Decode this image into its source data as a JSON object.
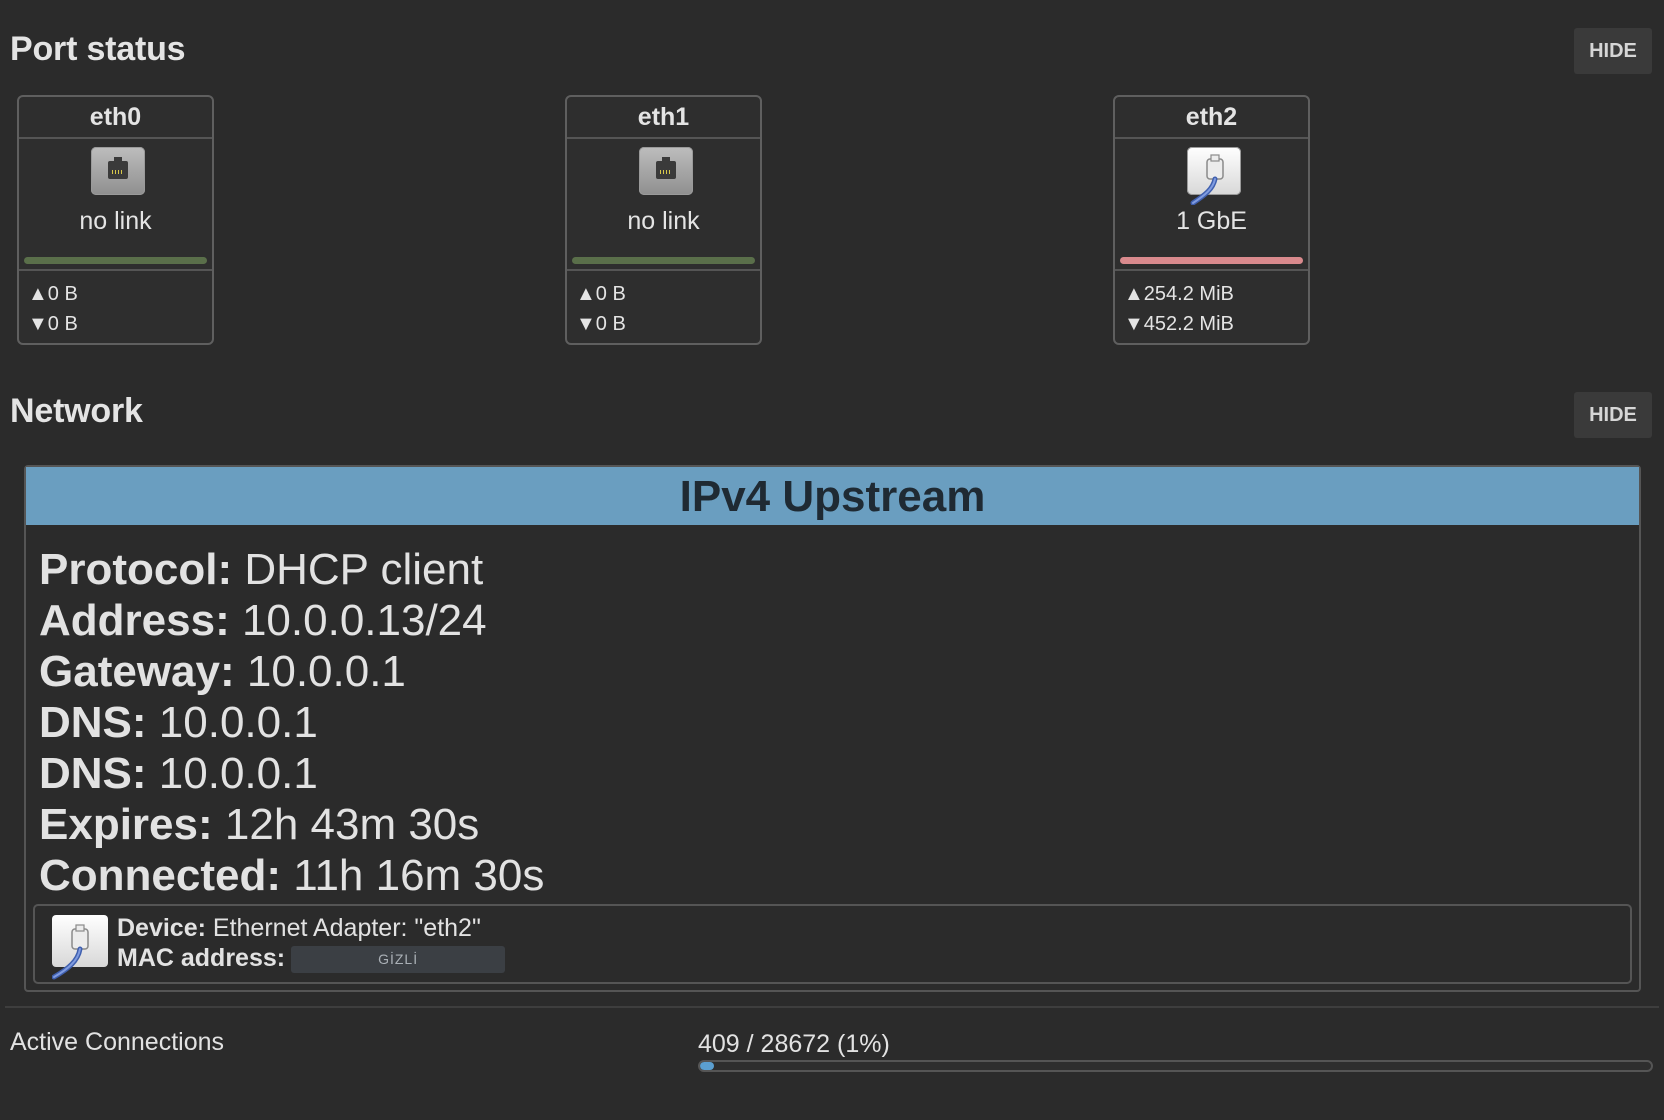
{
  "port_status": {
    "title": "Port status",
    "hide_label": "HIDE",
    "ports": [
      {
        "name": "eth0",
        "status": "no link",
        "up": false,
        "bar_color": "#5a6f4a",
        "tx": "0 B",
        "rx": "0 B"
      },
      {
        "name": "eth1",
        "status": "no link",
        "up": false,
        "bar_color": "#5a6f4a",
        "tx": "0 B",
        "rx": "0 B"
      },
      {
        "name": "eth2",
        "status": "1 GbE",
        "up": true,
        "bar_color": "#d98a8d",
        "tx": "254.2 MiB",
        "rx": "452.2 MiB"
      }
    ]
  },
  "network": {
    "title": "Network",
    "hide_label": "HIDE",
    "upstream": {
      "title": "IPv4 Upstream",
      "header_color": "#6a9ec0",
      "rows": [
        {
          "label": "Protocol:",
          "value": "DHCP client"
        },
        {
          "label": "Address:",
          "value": "10.0.0.13/24"
        },
        {
          "label": "Gateway:",
          "value": "10.0.0.1"
        },
        {
          "label": "DNS:",
          "value": "10.0.0.1"
        },
        {
          "label": "DNS:",
          "value": "10.0.0.1"
        },
        {
          "label": "Expires:",
          "value": "12h 43m 30s"
        },
        {
          "label": "Connected:",
          "value": "11h 16m 30s"
        }
      ],
      "device": {
        "device_label": "Device:",
        "device_value": "Ethernet Adapter: \"eth2\"",
        "mac_label": "MAC address:",
        "mac_value": "GİZLİ"
      }
    }
  },
  "active_connections": {
    "label": "Active Connections",
    "value_text": "409 / 28672 (1%)",
    "current": 409,
    "max": 28672,
    "fill_color": "#5b9fd0"
  }
}
